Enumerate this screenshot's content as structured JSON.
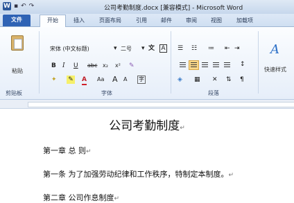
{
  "window": {
    "title": "公司考勤制度.docx [兼容模式] - Microsoft Word",
    "qat": {
      "save": "▪",
      "undo": "↶",
      "redo": "↷"
    }
  },
  "tabs": [
    "文件",
    "开始",
    "插入",
    "页面布局",
    "引用",
    "邮件",
    "审阅",
    "视图",
    "加载项"
  ],
  "ribbon": {
    "paste_label": "粘贴",
    "font_name": "宋体 (中文标题)",
    "font_size": "二号",
    "font_group_label": "字体",
    "paragraph_group_label": "段落",
    "clipboard_group_label": "剪贴板",
    "styles_label": "快速样式",
    "bold": "B",
    "italic": "I",
    "underline": "U",
    "strike": "abc",
    "sub": "x₂",
    "sup": "x²",
    "font_color": "A",
    "grow": "A",
    "shrink": "A",
    "change_case": "Aa",
    "phonetic": "文",
    "char_border": "A",
    "style_glyph": "A"
  },
  "document": {
    "title": "公司考勤制度",
    "paragraphs": [
      "第一章 总 则",
      "第一条 为了加强劳动纪律和工作秩序，特制定本制度。",
      "第二章 公司作息制度"
    ],
    "para_mark": "↵"
  },
  "colors": {
    "file_tab": "#2f63b5",
    "selected_button": "#fbd88a",
    "ribbon_bg": "#e6eef9"
  }
}
